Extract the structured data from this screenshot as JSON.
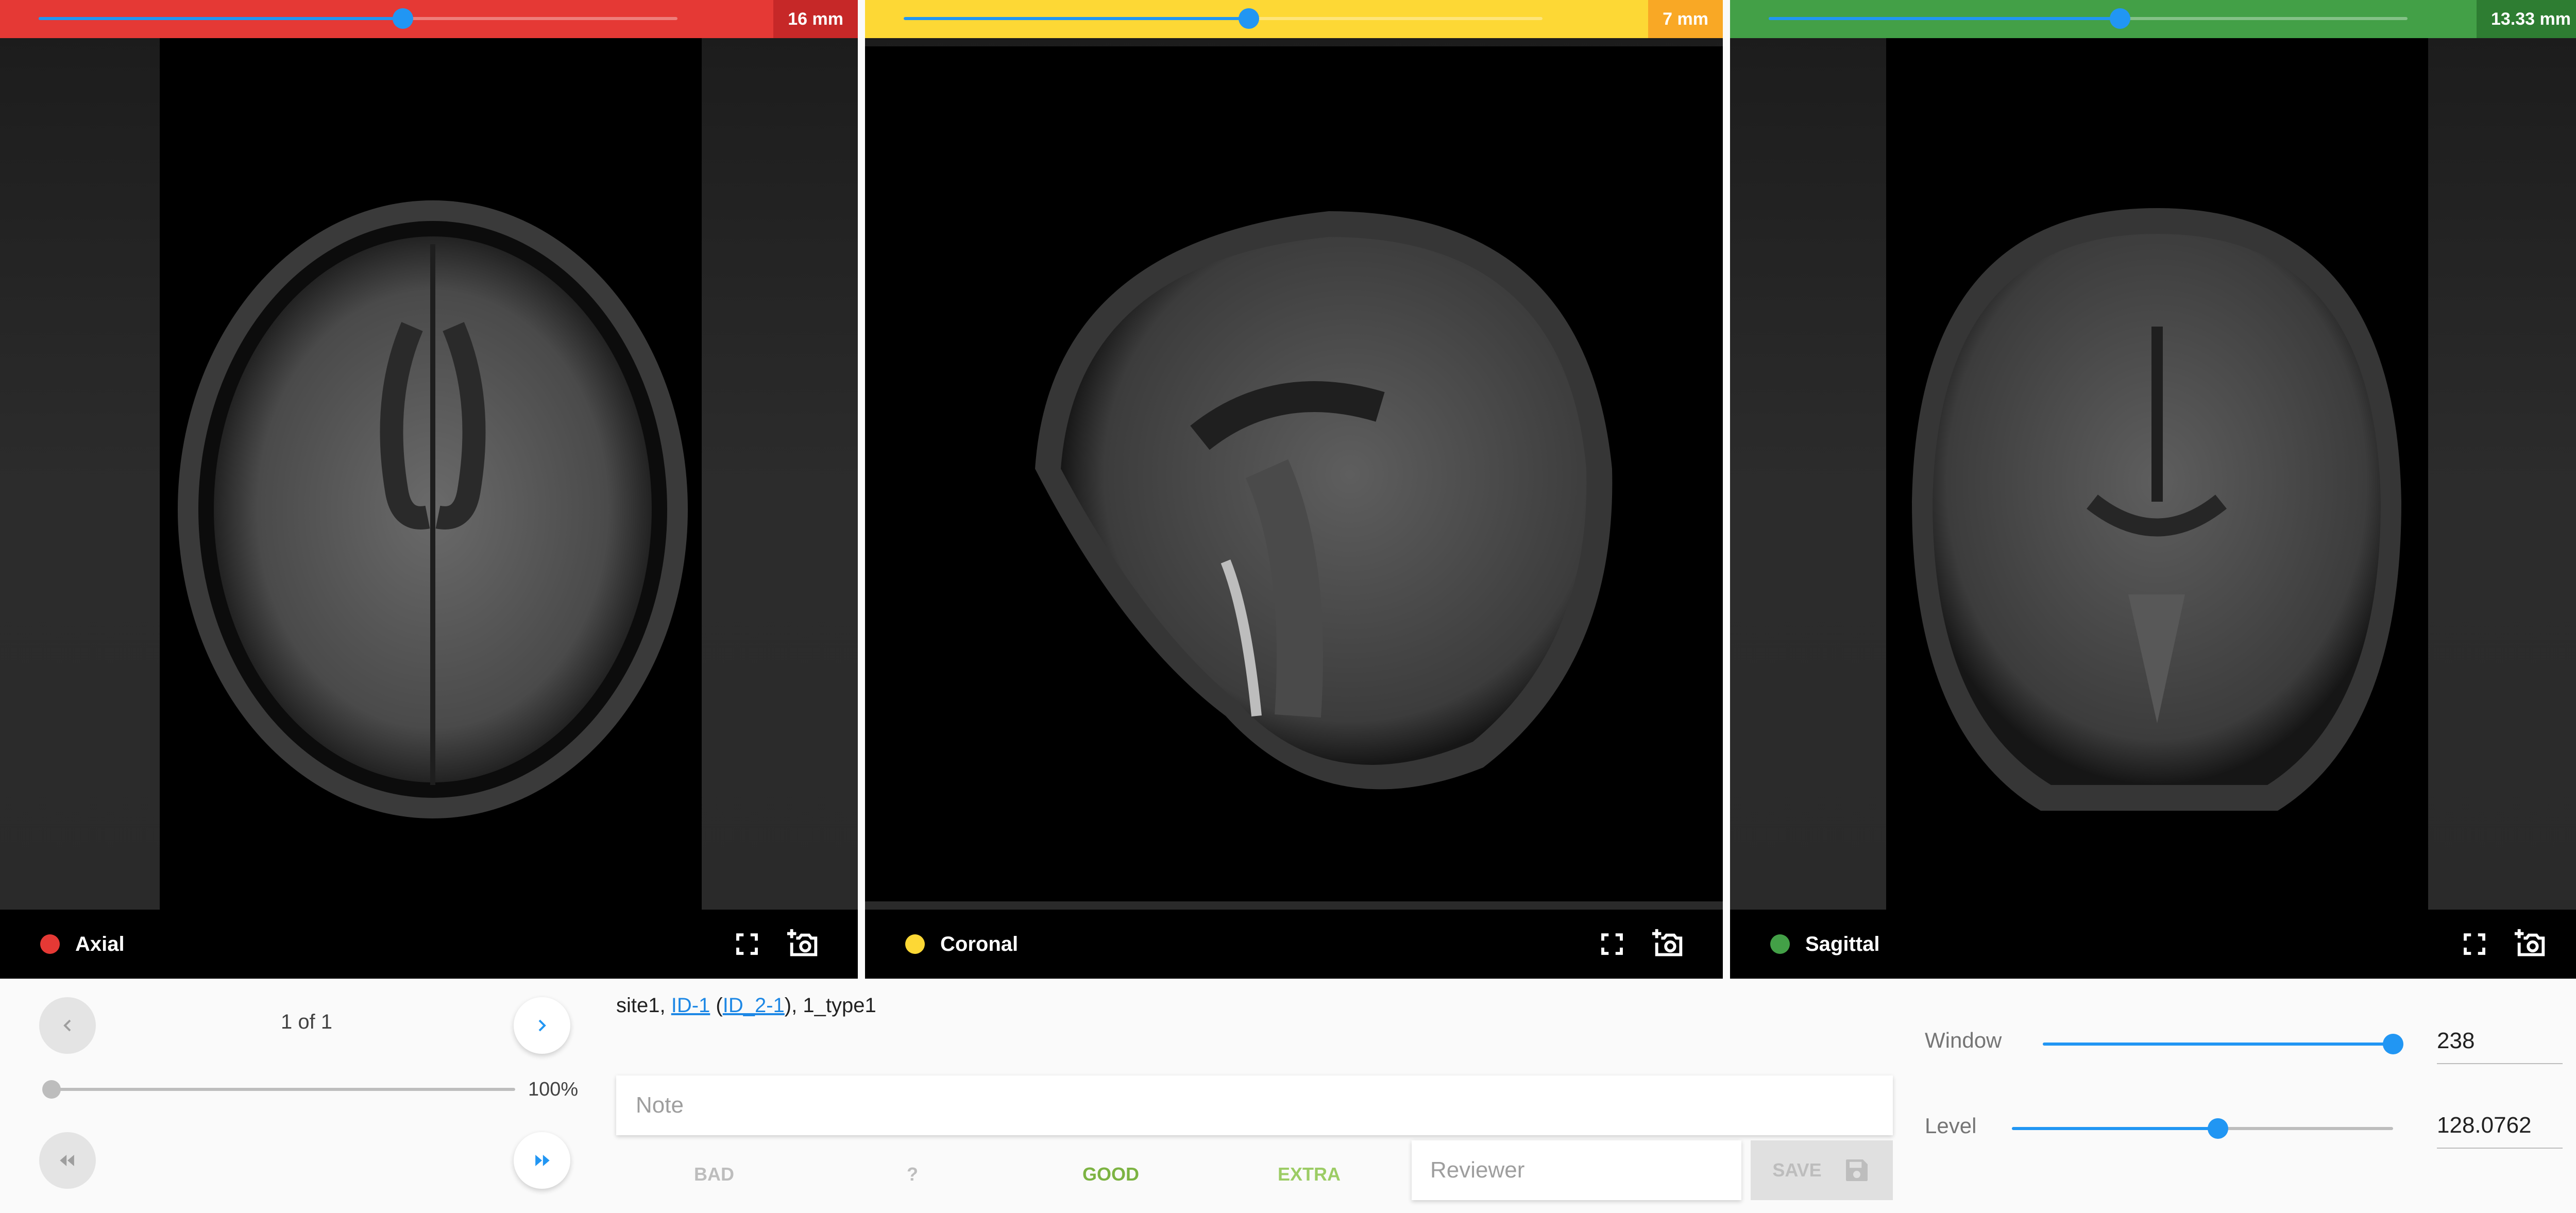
{
  "views": [
    {
      "label": "Axial",
      "mm": "16 mm",
      "slider_fraction": 0.57,
      "color": "#e53935",
      "tag_color": "#c62828"
    },
    {
      "label": "Coronal",
      "mm": "7 mm",
      "slider_fraction": 0.54,
      "color": "#fdd835",
      "tag_color": "#f9a825"
    },
    {
      "label": "Sagittal",
      "mm": "13.33 mm",
      "slider_fraction": 0.55,
      "color": "#43a047",
      "tag_color": "#2e7d32"
    }
  ],
  "icons": {
    "fullscreen": "fullscreen-icon",
    "screenshot": "add-camera-icon",
    "prev": "chevron-left-icon",
    "next": "chevron-right-icon",
    "rewind": "rewind-icon",
    "fast_forward": "fast-forward-icon",
    "save": "floppy-disk-icon"
  },
  "navigation": {
    "counter": "1 of 1",
    "zoom_label": "100%",
    "zoom_fraction": 0.0
  },
  "subject": {
    "site": "site1, ",
    "id": "ID-1",
    "open_paren": " (",
    "session_id": "ID_2-1",
    "close_tail": "), 1_type1"
  },
  "note": {
    "placeholder": "Note"
  },
  "ratings": {
    "bad": "BAD",
    "unsure": "?",
    "good": "GOOD",
    "extra": "EXTRA",
    "good_color": "#7cb342",
    "extra_color": "#9ccc65"
  },
  "reviewer": {
    "placeholder": "Reviewer"
  },
  "save": {
    "label": "SAVE"
  },
  "contrast": {
    "window_label": "Window",
    "window_value": "238",
    "window_fraction": 1.0,
    "level_label": "Level",
    "level_value": "128.0762",
    "level_fraction": 0.54
  },
  "accent_color": "#2196f3"
}
